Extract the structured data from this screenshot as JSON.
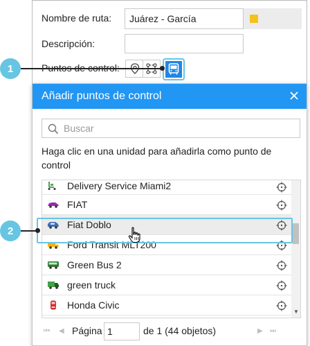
{
  "route_form": {
    "name_label": "Nombre de ruta:",
    "name_value": "Juárez - García",
    "swatch_color": "#f5c21a",
    "description_label": "Descripción:",
    "description_value": "",
    "checkpoints_label": "Puntos de control:"
  },
  "callouts": {
    "first": "1",
    "second": "2"
  },
  "dialog": {
    "title": "Añadir puntos de control",
    "search_placeholder": "Buscar",
    "hint": "Haga clic en una unidad para añadirla como punto de control",
    "units": [
      {
        "name": "Delivery Service Miami2",
        "icon": "delivery-scooter-icon"
      },
      {
        "name": "FIAT",
        "icon": "purple-car-icon"
      },
      {
        "name": "Fiat Doblo",
        "icon": "blue-car-icon"
      },
      {
        "name": "Ford Transit MLT200",
        "icon": "yellow-van-icon"
      },
      {
        "name": "Green Bus 2",
        "icon": "green-bus-icon"
      },
      {
        "name": "green truck",
        "icon": "green-truck-icon"
      },
      {
        "name": "Honda Civic",
        "icon": "red-car-icon"
      }
    ],
    "pager": {
      "page_label": "Página",
      "page_value": "1",
      "of_text": "de 1 (44 objetos)"
    }
  }
}
